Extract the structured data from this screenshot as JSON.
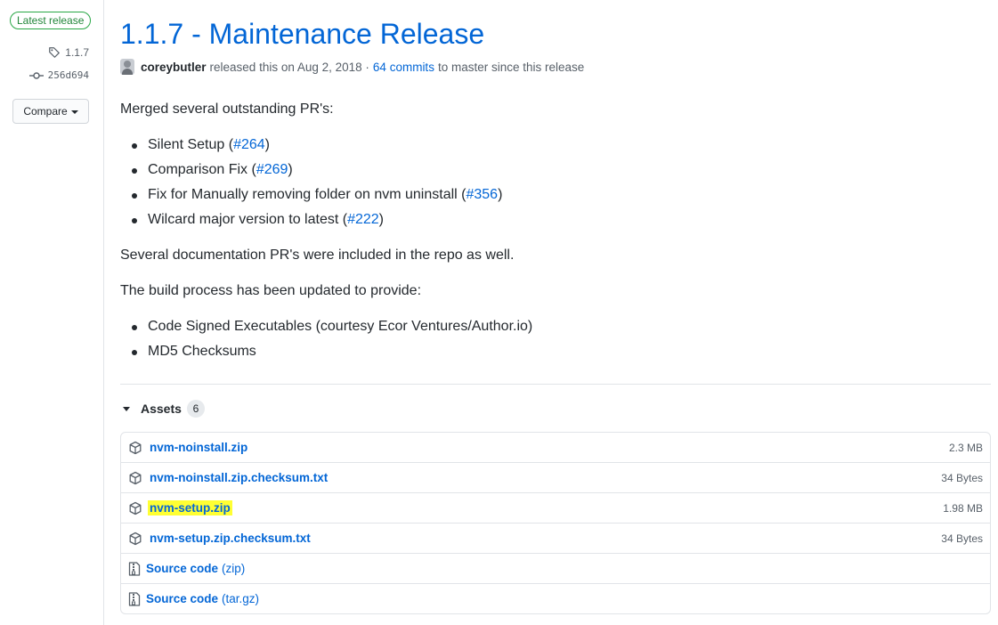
{
  "sidebar": {
    "badge": "Latest release",
    "tag": "1.1.7",
    "commit": "256d694",
    "compare_label": "Compare"
  },
  "release": {
    "title": "1.1.7 - Maintenance Release",
    "author": "coreybutler",
    "released_text": "released this on Aug 2, 2018 ·",
    "commits_link": "64 commits",
    "since_text": "to master since this release"
  },
  "notes": {
    "intro": "Merged several outstanding PR's:",
    "prs": [
      {
        "label": "Silent Setup",
        "ref": "#264"
      },
      {
        "label": "Comparison Fix",
        "ref": "#269"
      },
      {
        "label": "Fix for Manually removing folder on nvm uninstall",
        "ref": "#356"
      },
      {
        "label": "Wilcard major version to latest",
        "ref": "#222"
      }
    ],
    "docs_text": "Several documentation PR's were included in the repo as well.",
    "build_text": "The build process has been updated to provide:",
    "build_items": [
      "Code Signed Executables (courtesy Ecor Ventures/Author.io)",
      "MD5 Checksums"
    ]
  },
  "assets": {
    "label": "Assets",
    "count": "6",
    "files": [
      {
        "name": "nvm-noinstall.zip",
        "size": "2.3 MB",
        "highlighted": false
      },
      {
        "name": "nvm-noinstall.zip.checksum.txt",
        "size": "34 Bytes",
        "highlighted": false
      },
      {
        "name": "nvm-setup.zip",
        "size": "1.98 MB",
        "highlighted": true
      },
      {
        "name": "nvm-setup.zip.checksum.txt",
        "size": "34 Bytes",
        "highlighted": false
      }
    ],
    "sources": [
      {
        "name": "Source code",
        "format": "(zip)"
      },
      {
        "name": "Source code",
        "format": "(tar.gz)"
      }
    ],
    "highlight_color": "#ffff33"
  },
  "colors": {
    "link": "#0366d6",
    "badge_green": "#28a745",
    "text": "#24292e",
    "muted": "#586069"
  },
  "icons": {
    "tag": "tag-icon",
    "commit": "git-commit-icon",
    "package": "package-icon",
    "archive": "file-zip-icon"
  }
}
